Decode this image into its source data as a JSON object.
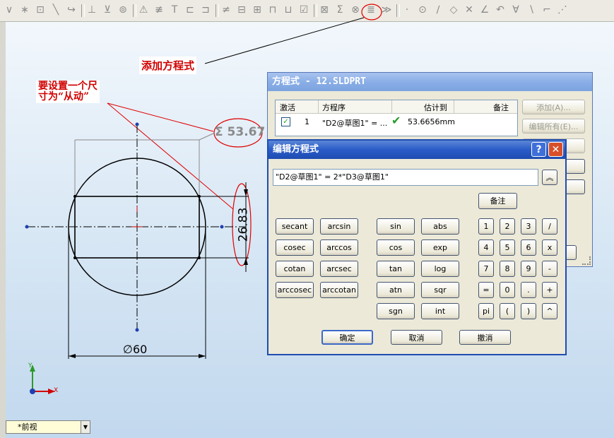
{
  "toolbar": {
    "icons": [
      "dimension-icon",
      "sketch-point-icon",
      "sketch-rect-icon",
      "sketch-arc-icon",
      "sketch-tangent-icon",
      "relation-icon",
      "mirror-icon",
      "offset-icon",
      "warning-icon",
      "trim-icon",
      "extend-icon",
      "convert-icon",
      "split-icon",
      "pattern-icon",
      "block-icon",
      "move-icon",
      "fix-icon",
      "merge-icon",
      "check-icon",
      "shade-icon",
      "equations-icon",
      "parameters-icon",
      "rebuild-icon",
      "display-icon",
      "point-icon",
      "circle-icon",
      "line-icon",
      "polygon-icon",
      "cross-icon",
      "angle-icon",
      "fillet-icon",
      "chamfer-icon",
      "slash-icon",
      "corner-icon",
      "extra-icon"
    ]
  },
  "annotations": {
    "add_equation": "添加方程式",
    "set_driven": "要设置一个尺\n寸为“从动”"
  },
  "drawing": {
    "driven_dim": "Σ 53.67",
    "vertical_dim": "26.83",
    "diameter_dim": "∅60",
    "axis_y": "Y",
    "axis_x": "X"
  },
  "view_combo": {
    "value": "*前视"
  },
  "equations_window": {
    "title": "方程式 - 12.SLDPRT",
    "columns": {
      "active": "激活",
      "equation": "方程序",
      "evaluates_to": "估计到",
      "comment": "备注"
    },
    "row": {
      "index": "1",
      "equation": "\"D2@草图1\" = ...",
      "value": "53.6656mm"
    },
    "buttons": {
      "add": "添加(A)...",
      "edit_all": "编辑所有(E)...",
      "partial": "E)..."
    }
  },
  "edit_dialog": {
    "title": "编辑方程式",
    "equation_text": "\"D2@草图1\" = 2*\"D3@草图1\"",
    "comment_button": "备注",
    "functions_left": [
      "secant",
      "arcsin",
      "cosec",
      "arccos",
      "cotan",
      "arcsec",
      "arccosec",
      "arccotan"
    ],
    "functions_mid": [
      "sin",
      "abs",
      "cos",
      "exp",
      "tan",
      "log",
      "atn",
      "sqr",
      "sgn",
      "int"
    ],
    "keypad": [
      "1",
      "2",
      "3",
      "/",
      "4",
      "5",
      "6",
      "x",
      "7",
      "8",
      "9",
      "-",
      "=",
      "0",
      ".",
      "+",
      "pi",
      "(",
      ")",
      "^"
    ],
    "ok": "确定",
    "cancel": "取消",
    "undo": "撤消"
  },
  "colors": {
    "annotation_red": "#d00000",
    "title_blue": "#2a5cc8",
    "check_green": "#2a9a2a"
  }
}
